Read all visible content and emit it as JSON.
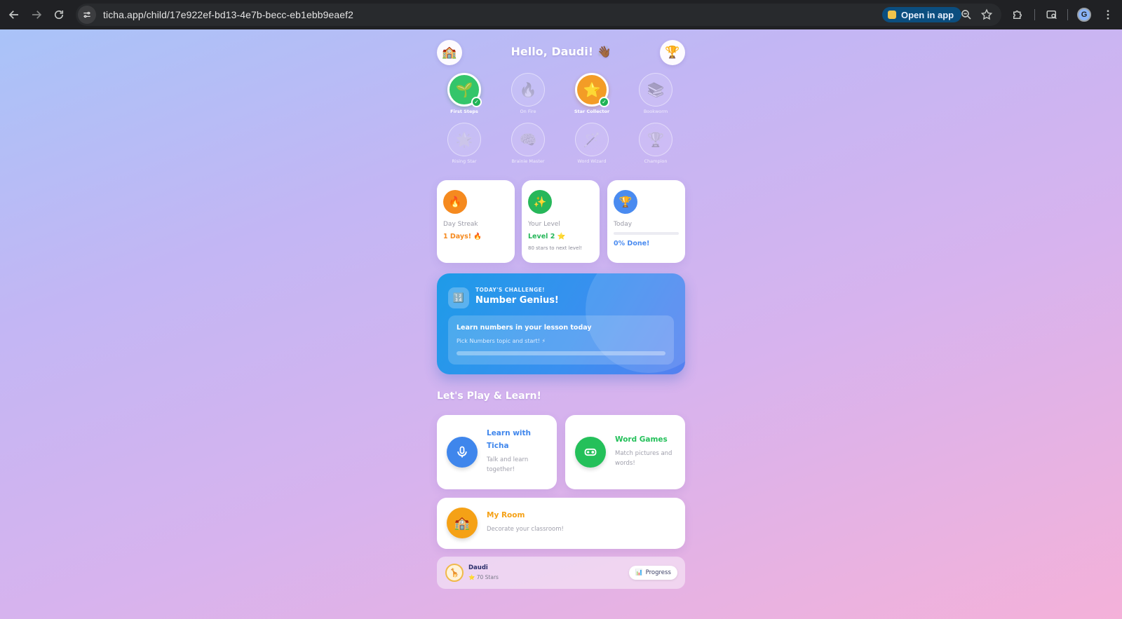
{
  "browser": {
    "url": "ticha.app/child/17e922ef-bd13-4e7b-becc-eb1ebb9eaef2",
    "open_in_app_label": "Open in app",
    "profile_initial": "G"
  },
  "header": {
    "greeting": "Hello, Daudi! 👋🏾",
    "home_icon": "🏫",
    "trophy_icon": "🏆"
  },
  "badges": [
    {
      "label": "First Steps",
      "icon": "🌱",
      "earned": true,
      "color": "#34c56a"
    },
    {
      "label": "On Fire",
      "icon": "🔥",
      "earned": false
    },
    {
      "label": "Star Collector",
      "icon": "⭐",
      "earned": true,
      "color": "#f39c26"
    },
    {
      "label": "Bookworm",
      "icon": "📚",
      "earned": false
    },
    {
      "label": "Rising Star",
      "icon": "🌟",
      "earned": false
    },
    {
      "label": "Brainie Master",
      "icon": "🧠",
      "earned": false
    },
    {
      "label": "Word Wizard",
      "icon": "🪄",
      "earned": false
    },
    {
      "label": "Champion",
      "icon": "🏆",
      "earned": false
    }
  ],
  "stats": {
    "streak": {
      "title": "Day Streak",
      "value": "1 Days! 🔥",
      "icon": "🔥",
      "color": "#f58a1f"
    },
    "level": {
      "title": "Your Level",
      "value": "Level 2 ⭐",
      "sub": "80 stars to next level!",
      "icon": "✨",
      "color": "#27b75a"
    },
    "today": {
      "title": "Today",
      "value": "0% Done!",
      "progress": 0,
      "icon": "🏆",
      "color": "#4a8bf0"
    }
  },
  "challenge": {
    "kicker": "TODAY'S CHALLENGE!",
    "title": "Number Genius!",
    "icon": "🔢",
    "task": "Learn numbers in your lesson today",
    "hint": "Pick Numbers topic and start! ⚡",
    "progress": 0
  },
  "section": {
    "title": "Let's Play & Learn!"
  },
  "activities": {
    "learn": {
      "title_line1": "Learn with",
      "title_line2": "Ticha",
      "desc_line1": "Talk and learn",
      "desc_line2": "together!",
      "color": "#3f86ec",
      "icon": "microphone-icon"
    },
    "word": {
      "title": "Word Games",
      "desc_line1": "Match pictures and",
      "desc_line2": "words!",
      "color": "#24c05a",
      "icon": "gamepad-icon"
    },
    "room": {
      "title": "My Room",
      "desc": "Decorate your classroom!",
      "color": "#f5a116",
      "icon": "🏫"
    }
  },
  "bottom": {
    "name": "Daudi",
    "stars": "⭐ 70 Stars",
    "avatar": "🦒",
    "progress_label": "Progress",
    "progress_icon": "📊"
  }
}
